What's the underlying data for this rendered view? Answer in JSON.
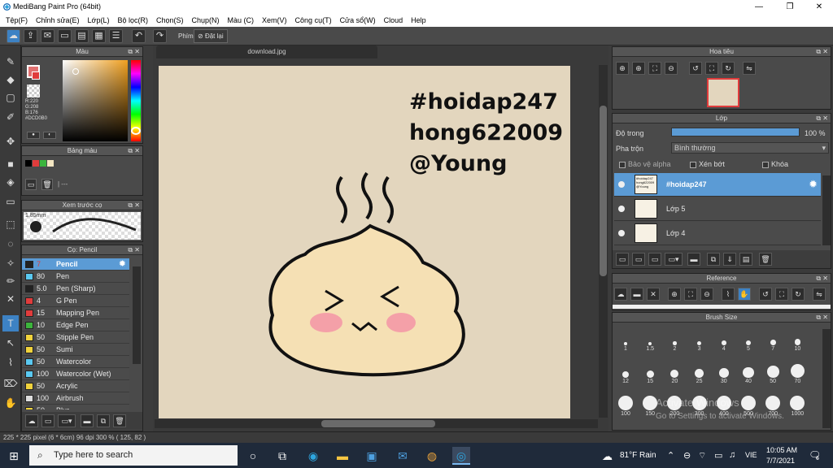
{
  "window": {
    "title": "MediBang Paint Pro (64bit)",
    "min": "—",
    "max": "❐",
    "close": "✕"
  },
  "menu": [
    "Tệp(F)",
    "Chỉnh sửa(E)",
    "Lớp(L)",
    "Bộ lọc(R)",
    "Chọn(S)",
    "Chụp(N)",
    "Màu (C)",
    "Xem(V)",
    "Công cụ(T)",
    "Cửa sổ(W)",
    "Cloud",
    "Help"
  ],
  "toolbar": {
    "shortcut_label": "Phím",
    "reset_label": "Đặt lại"
  },
  "color_panel": {
    "title": "Màu",
    "r": "R:220",
    "g": "G:208",
    "b": "B:176",
    "hex": "#DCD0B0"
  },
  "palette_panel": {
    "title": "Bảng màu",
    "footer": "| ---"
  },
  "brush_preview": {
    "title": "Xem trước cọ",
    "size": "1.85mm"
  },
  "brush_panel": {
    "title": "Cọ: Pencil",
    "items": [
      {
        "size": "7",
        "name": "Pencil",
        "color": "#222222"
      },
      {
        "size": "80",
        "name": "Pen",
        "color": "#5ac8f0"
      },
      {
        "size": "5.0",
        "name": "Pen (Sharp)",
        "color": "#222222"
      },
      {
        "size": "4",
        "name": "G Pen",
        "color": "#e03c3c"
      },
      {
        "size": "15",
        "name": "Mapping Pen",
        "color": "#e03c3c"
      },
      {
        "size": "10",
        "name": "Edge Pen",
        "color": "#3cb43c"
      },
      {
        "size": "50",
        "name": "Stipple Pen",
        "color": "#f0d23c"
      },
      {
        "size": "50",
        "name": "Sumi",
        "color": "#f0d23c"
      },
      {
        "size": "50",
        "name": "Watercolor",
        "color": "#5ac8f0"
      },
      {
        "size": "100",
        "name": "Watercolor (Wet)",
        "color": "#5ac8f0"
      },
      {
        "size": "50",
        "name": "Acrylic",
        "color": "#f0d23c"
      },
      {
        "size": "100",
        "name": "Airbrush",
        "color": "#dddddd"
      },
      {
        "size": "50",
        "name": "Blur",
        "color": "#f0d23c"
      }
    ]
  },
  "canvas": {
    "tab": "download.jpg",
    "lines": [
      "#hoidap247",
      "hong622009",
      "@Young"
    ]
  },
  "navigator": {
    "title": "Hoa tiêu"
  },
  "layer_panel": {
    "title": "Lớp",
    "opacity_label": "Độ trong",
    "opacity_value": "100 %",
    "blend_label": "Pha trộn",
    "blend_value": "Bình thường",
    "protect_alpha": "Bảo vệ alpha",
    "clipping": "Xén bớt",
    "lock": "Khóa",
    "layers": [
      {
        "name": "#hoidap247",
        "thumb": "#hoidap247 hong622009 @Young"
      },
      {
        "name": "Lớp 5",
        "thumb": ""
      },
      {
        "name": "Lớp 4",
        "thumb": ""
      }
    ]
  },
  "reference_panel": {
    "title": "Reference"
  },
  "brush_size_panel": {
    "title": "Brush Size",
    "sizes": [
      "1",
      "1.5",
      "2",
      "3",
      "4",
      "5",
      "7",
      "10",
      "12",
      "15",
      "20",
      "25",
      "30",
      "40",
      "50",
      "70",
      "100",
      "150",
      "200",
      "300",
      "400",
      "500",
      "700",
      "1000"
    ]
  },
  "watermark": {
    "line1": "Activate Windows",
    "line2": "Go to Settings to activate Windows."
  },
  "status": "225 * 225 pixel   (6 * 6cm)   96 dpi   300 %   ( 125, 82 )",
  "taskbar": {
    "search_placeholder": "Type here to search",
    "weather": "81°F  Rain",
    "lang": "VIE",
    "time": "10:05 AM",
    "date": "7/7/2021",
    "notif_count": "6"
  }
}
